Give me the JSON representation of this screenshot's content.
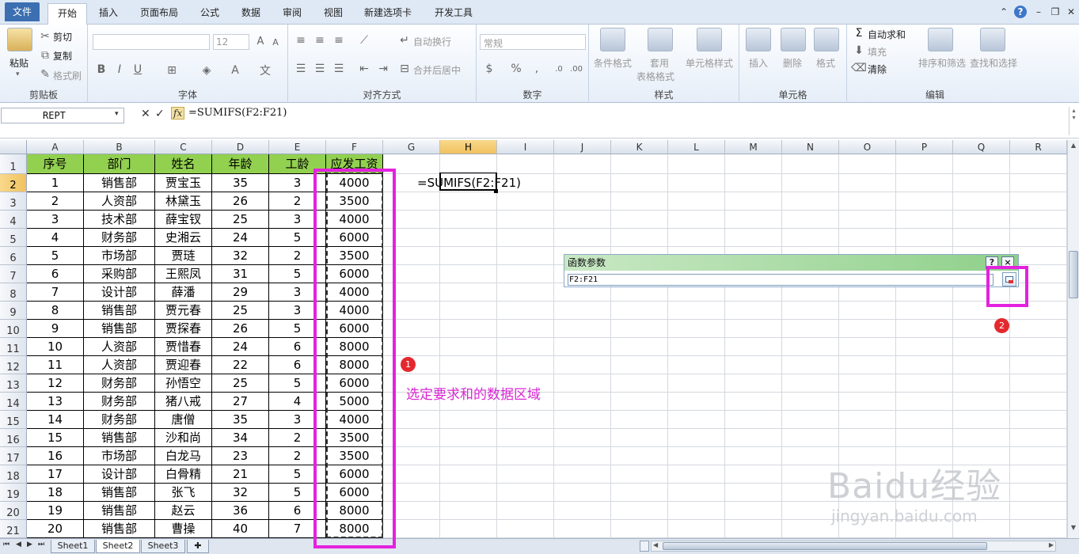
{
  "tabs": [
    "文件",
    "开始",
    "插入",
    "页面布局",
    "公式",
    "数据",
    "审阅",
    "视图",
    "新建选项卡",
    "开发工具"
  ],
  "ribbon": {
    "clipboard": {
      "label": "剪贴板",
      "paste": "粘贴",
      "cut": "剪切",
      "copy": "复制",
      "format_painter": "格式刷"
    },
    "font": {
      "label": "字体",
      "size": "12"
    },
    "align": {
      "label": "对齐方式",
      "wrap": "自动换行",
      "merge": "合并后居中"
    },
    "number": {
      "label": "数字",
      "format": "常规"
    },
    "styles": {
      "label": "样式",
      "cond": "条件格式",
      "table1": "套用",
      "table2": "表格格式",
      "cell": "单元格样式"
    },
    "cells": {
      "label": "单元格",
      "insert": "插入",
      "delete": "删除",
      "format": "格式"
    },
    "editing": {
      "label": "编辑",
      "autosum": "自动求和",
      "fill": "填充",
      "clear": "清除",
      "sort": "排序和筛选",
      "find": "查找和选择"
    }
  },
  "formula_bar": {
    "name_box": "REPT",
    "formula": "=SUMIFS(F2:F21)"
  },
  "columns": [
    "A",
    "B",
    "C",
    "D",
    "E",
    "F",
    "G",
    "H",
    "I",
    "J",
    "K",
    "L",
    "M",
    "N",
    "O",
    "P",
    "Q",
    "R"
  ],
  "headers": [
    "序号",
    "部门",
    "姓名",
    "年龄",
    "工龄",
    "应发工资"
  ],
  "rows": [
    [
      "1",
      "销售部",
      "贾宝玉",
      "35",
      "3",
      "4000"
    ],
    [
      "2",
      "人资部",
      "林黛玉",
      "26",
      "2",
      "3500"
    ],
    [
      "3",
      "技术部",
      "薛宝钗",
      "25",
      "3",
      "4000"
    ],
    [
      "4",
      "财务部",
      "史湘云",
      "24",
      "5",
      "6000"
    ],
    [
      "5",
      "市场部",
      "贾琏",
      "32",
      "2",
      "3500"
    ],
    [
      "6",
      "采购部",
      "王熙凤",
      "31",
      "5",
      "6000"
    ],
    [
      "7",
      "设计部",
      "薛潘",
      "29",
      "3",
      "4000"
    ],
    [
      "8",
      "销售部",
      "贾元春",
      "25",
      "3",
      "4000"
    ],
    [
      "9",
      "销售部",
      "贾探春",
      "26",
      "5",
      "6000"
    ],
    [
      "10",
      "人资部",
      "贾惜春",
      "24",
      "6",
      "8000"
    ],
    [
      "11",
      "人资部",
      "贾迎春",
      "22",
      "6",
      "8000"
    ],
    [
      "12",
      "财务部",
      "孙悟空",
      "25",
      "5",
      "6000"
    ],
    [
      "13",
      "财务部",
      "猪八戒",
      "27",
      "4",
      "5000"
    ],
    [
      "14",
      "财务部",
      "唐僧",
      "35",
      "3",
      "4000"
    ],
    [
      "15",
      "销售部",
      "沙和尚",
      "34",
      "2",
      "3500"
    ],
    [
      "16",
      "市场部",
      "白龙马",
      "23",
      "2",
      "3500"
    ],
    [
      "17",
      "设计部",
      "白骨精",
      "21",
      "5",
      "6000"
    ],
    [
      "18",
      "销售部",
      "张飞",
      "32",
      "5",
      "6000"
    ],
    [
      "19",
      "销售部",
      "赵云",
      "36",
      "6",
      "8000"
    ],
    [
      "20",
      "销售部",
      "曹操",
      "40",
      "7",
      "8000"
    ]
  ],
  "cell_g2": "=SUMIFS(F2:F21)",
  "dialog": {
    "title": "函数参数",
    "input": "F2:F21",
    "help": "?",
    "close": "×"
  },
  "annotation": "选定要求和的数据区域",
  "badges": [
    "1",
    "2"
  ],
  "sheets": [
    "Sheet1",
    "Sheet2",
    "Sheet3"
  ],
  "watermark": "Baidu经验",
  "watermark_url": "jingyan.baidu.com",
  "colors": {
    "header_fill": "#92d050",
    "highlight": "#e322de",
    "badge": "#e3292e",
    "active_col": "#f1c15f"
  }
}
